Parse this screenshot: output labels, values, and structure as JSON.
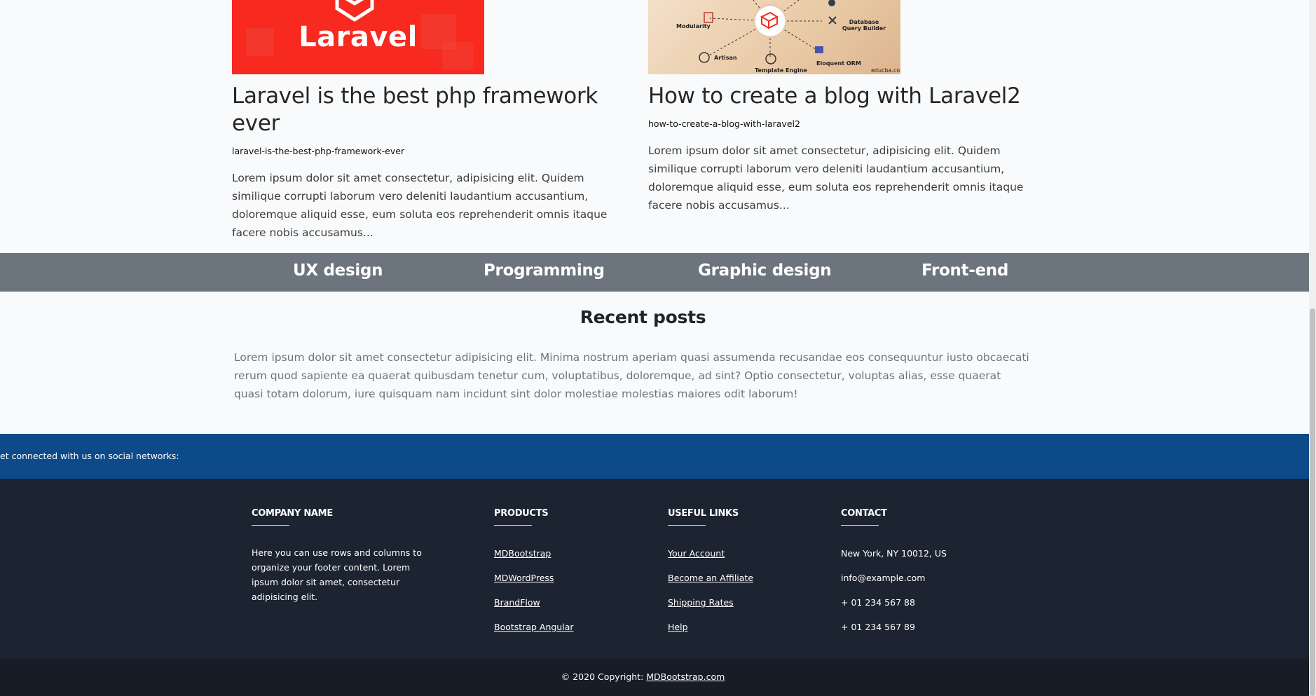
{
  "posts": [
    {
      "thumb_text": "Laravel",
      "title": "Laravel is the best php framework ever",
      "slug": "laravel-is-the-best-php-framework-ever",
      "excerpt": "Lorem ipsum dolor sit amet consectetur, adipisicing elit. Quidem similique corrupti laborum vero deleniti laudantium accusantium, doloremque aliquid esse, eum soluta eos reprehenderit omnis itaque facere nobis accusamus..."
    },
    {
      "thumb_labels": {
        "modularity": "Modularity",
        "query": "Database Query Builder",
        "artisan": "Artisan",
        "template": "Template Engine",
        "orm": "Eloquent ORM",
        "site": "educba.com"
      },
      "title": "How to create a blog with Laravel2",
      "slug": "how-to-create-a-blog-with-laravel2",
      "excerpt": "Lorem ipsum dolor sit amet consectetur, adipisicing elit. Quidem similique corrupti laborum vero deleniti laudantium accusantium, doloremque aliquid esse, eum soluta eos reprehenderit omnis itaque facere nobis accusamus..."
    }
  ],
  "categories": [
    "UX design",
    "Programming",
    "Graphic design",
    "Front-end"
  ],
  "recent": {
    "title": "Recent posts",
    "body": "Lorem ipsum dolor sit amet consectetur adipisicing elit. Minima nostrum aperiam quasi assumenda recusandae eos consequuntur iusto obcaecati rerum quod sapiente ea quaerat quibusdam tenetur cum, voluptatibus, doloremque, ad sint? Optio consectetur, voluptas alias, esse quaerat quasi totam dolorum, iure quisquam nam incidunt sint dolor molestiae molestias maiores odit laborum!"
  },
  "social": {
    "text": "et connected with us on social networks:"
  },
  "footer": {
    "company": {
      "heading": "COMPANY NAME",
      "about": "Here you can use rows and columns to organize your footer content. Lorem ipsum dolor sit amet, consectetur adipisicing elit."
    },
    "products": {
      "heading": "PRODUCTS",
      "links": [
        "MDBootstrap",
        "MDWordPress",
        "BrandFlow",
        "Bootstrap Angular"
      ]
    },
    "useful": {
      "heading": "USEFUL LINKS",
      "links": [
        "Your Account",
        "Become an Affiliate",
        "Shipping Rates",
        "Help"
      ]
    },
    "contact": {
      "heading": "CONTACT",
      "items": [
        "New York, NY 10012, US",
        "info@example.com",
        "+ 01 234 567 88",
        "+ 01 234 567 89"
      ]
    }
  },
  "copyright": {
    "text": "© 2020 Copyright: ",
    "link": "MDBootstrap.com"
  },
  "colors": {
    "laravel_red": "#f8291e",
    "category_bar": "#6c757d",
    "social_bar": "#0c4a8a",
    "footer": "#1c2331",
    "copyright": "#171c27"
  }
}
